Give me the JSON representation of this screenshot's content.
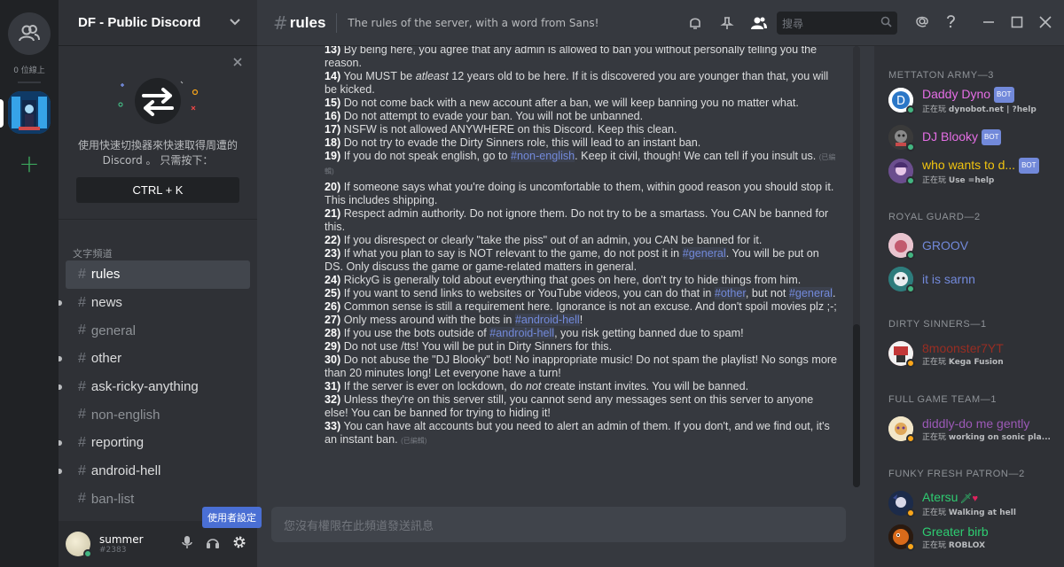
{
  "guilds": {
    "online_count": "0 位線上"
  },
  "sidebar": {
    "server_name": "DF - Public Discord",
    "switcher_text": "使用快速切換器來快速取得周遭的 Discord 。 只需按下：",
    "switcher_shortcut": "CTRL + K",
    "category": "文字頻道",
    "channels": [
      {
        "name": "rules"
      },
      {
        "name": "news"
      },
      {
        "name": "general"
      },
      {
        "name": "other"
      },
      {
        "name": "ask-ricky-anything"
      },
      {
        "name": "non-english"
      },
      {
        "name": "reporting"
      },
      {
        "name": "android-hell"
      },
      {
        "name": "ban-list"
      }
    ],
    "user": {
      "name": "summer",
      "tag": "#2383"
    },
    "tooltip": "使用者設定"
  },
  "header": {
    "channel": "rules",
    "topic": "The rules of the server, with a word from Sans!",
    "search_placeholder": "搜尋"
  },
  "messages": {
    "edited": "(已編輯)",
    "r13_num": "13)",
    "r13": " By being here, you agree that any admin is allowed to ban you without personally telling you the reason.",
    "r14_num": "14)",
    "r14_a": " You MUST be ",
    "r14_em": "atleast",
    "r14_b": " 12 years old to be here. If it is discovered you are younger than that, you will be kicked.",
    "r15_num": "15)",
    "r15": " Do not come back with a new account after a ban, we will keep banning you no matter what.",
    "r16_num": "16)",
    "r16": " Do not attempt to evade your ban. You will not be unbanned.",
    "r17_num": "17)",
    "r17": " NSFW is not allowed ANYWHERE on this Discord. Keep this clean.",
    "r18_num": "18)",
    "r18": " Do not try to evade the Dirty Sinners role, this will lead to an instant ban.",
    "r19_num": "19)",
    "r19_a": " If you do not speak english, go to ",
    "r19_m": "#non-english",
    "r19_b": ". Keep it civil, though! We can tell if you insult us.",
    "r20_num": "20)",
    "r20": " If someone says what you're doing is uncomfortable to them, within good reason you should stop it. This includes shipping.",
    "r21_num": "21)",
    "r21": " Respect admin authority. Do not ignore them. Do not try to be a smartass. You CAN be banned for this.",
    "r22_num": "22)",
    "r22": " If you disrespect or clearly \"take the piss\" out of an admin, you CAN be banned for it.",
    "r23_num": "23)",
    "r23_a": " If what you plan to say is NOT relevant to the game, do not post it in ",
    "r23_m": "#general",
    "r23_b": ". You will be put on DS. Only discuss the game or game-related matters in general.",
    "r24_num": "24)",
    "r24": " RickyG is generally told about everything that goes on here, don't try to hide things from him.",
    "r25_num": "25)",
    "r25_a": " If you want to send links to websites or YouTube videos, you can do that in ",
    "r25_m": "#other",
    "r25_b": ", but not ",
    "r25_m2": "#general",
    "r25_c": ".",
    "r26_num": "26)",
    "r26": " Common sense is still a requirement here. Ignorance is not an excuse. And don't spoil movies plz ;-;",
    "r27_num": "27)",
    "r27_a": " Only mess around with the bots in ",
    "r27_m": "#android-hell",
    "r27_b": "!",
    "r28_num": "28)",
    "r28_a": " If you use the bots outside of ",
    "r28_m": "#android-hell",
    "r28_b": ", you risk getting banned due to spam!",
    "r29_num": "29)",
    "r29": " Do not use /tts! You will be put in Dirty Sinners for this.",
    "r30_num": "30)",
    "r30": " Do not abuse the \"DJ Blooky\" bot! No inappropriate music! Do not spam the playlist! No songs more than 20 minutes long! Let everyone have a turn!",
    "r31_num": "31)",
    "r31_a": " If the server is ever on lockdown, do ",
    "r31_em": "not",
    "r31_b": " create instant invites. You will be banned.",
    "r32_num": "32)",
    "r32": " Unless they're on this server still, you cannot send any messages sent on this server to anyone else! You can be banned for trying to hiding it!",
    "r33_num": "33)",
    "r33": " You can have alt accounts but you need to alert an admin of them. If you don't, and we find out, it's an instant ban."
  },
  "composer": {
    "placeholder": "您沒有權限在此頻道發送訊息"
  },
  "members": {
    "playing_prefix": "正在玩",
    "bot_label": "BOT",
    "roles": [
      {
        "title": "METTATON ARMY—3"
      },
      {
        "title": "ROYAL GUARD—2"
      },
      {
        "title": "DIRTY SINNERS—1"
      },
      {
        "title": "FULL GAME TEAM—1"
      },
      {
        "title": "FUNKY FRESH PATRON—2"
      }
    ],
    "list": [
      {
        "name": "Daddy Dyno",
        "color": "#e56ee5",
        "bot": true,
        "activity": "dynobot.net | ?help"
      },
      {
        "name": "DJ Blooky",
        "color": "#e56ee5",
        "bot": true,
        "activity": ""
      },
      {
        "name": "who wants to d...",
        "color": "#f1c40f",
        "bot": true,
        "activity": "Use =help"
      },
      {
        "name": "GROOV",
        "color": "#7289da",
        "bot": false,
        "activity": ""
      },
      {
        "name": "it is sarnn",
        "color": "#7289da",
        "bot": false,
        "activity": ""
      },
      {
        "name": "8moonster7YT",
        "color": "#992d22",
        "bot": false,
        "activity": "Kega Fusion"
      },
      {
        "name": "diddly-do me gently",
        "color": "#9b59b6",
        "bot": false,
        "activity": "working on sonic pla..."
      },
      {
        "name": "Atersu",
        "color": "#2ecc71",
        "bot": false,
        "activity": "Walking at hell"
      },
      {
        "name": "Greater birb",
        "color": "#2ecc71",
        "bot": false,
        "activity": "ROBLOX"
      }
    ]
  }
}
